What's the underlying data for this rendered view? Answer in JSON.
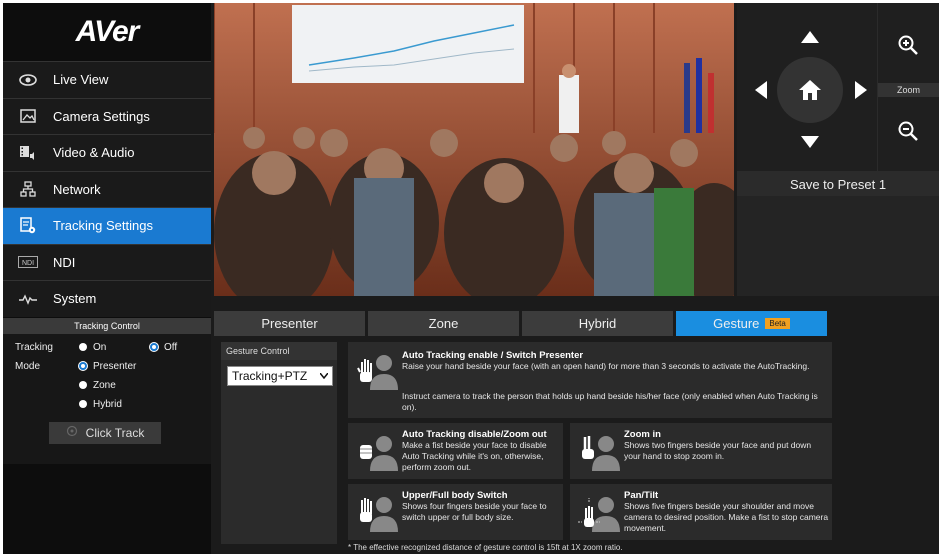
{
  "brand": {
    "logo_text": "AVer"
  },
  "sidebar": {
    "items": [
      {
        "label": "Live View",
        "icon": "eye-icon"
      },
      {
        "label": "Camera Settings",
        "icon": "image-icon"
      },
      {
        "label": "Video & Audio",
        "icon": "film-speaker-icon"
      },
      {
        "label": "Network",
        "icon": "network-icon"
      },
      {
        "label": "Tracking Settings",
        "icon": "settings-doc-icon",
        "active": true
      },
      {
        "label": "NDI",
        "icon": "ndi-icon"
      },
      {
        "label": "System",
        "icon": "pulse-icon"
      }
    ]
  },
  "tracking_control": {
    "header": "Tracking Control",
    "tracking_label": "Tracking",
    "mode_label": "Mode",
    "on_label": "On",
    "off_label": "Off",
    "tracking_selected": "Off",
    "modes": [
      "Presenter",
      "Zone",
      "Hybrid"
    ],
    "mode_selected": "Presenter",
    "click_track_label": "Click Track"
  },
  "ptz": {
    "zoom_label": "Zoom",
    "preset_label": "Save to Preset 1"
  },
  "tabs": [
    {
      "label": "Presenter"
    },
    {
      "label": "Zone"
    },
    {
      "label": "Hybrid"
    },
    {
      "label": "Gesture",
      "badge": "Beta",
      "active": true
    }
  ],
  "gesture": {
    "panel_title": "Gesture Control",
    "select_value": "Tracking+PTZ",
    "cards": [
      {
        "title": "Auto Tracking enable / Switch Presenter",
        "desc1": "Raise your hand beside your face (with an open hand) for more than 3 seconds to activate the AutoTracking.",
        "desc2": "Instruct camera to track the person that holds up hand beside his/her face (only enabled when Auto Tracking is on)."
      },
      {
        "title": "Auto Tracking disable/Zoom out",
        "desc1": "Make a fist beside your face to disable Auto Tracking while it's on, otherwise, perform zoom out."
      },
      {
        "title": "Zoom in",
        "desc1": "Shows two fingers beside your face and put down your hand to stop zoom in."
      },
      {
        "title": "Upper/Full body Switch",
        "desc1": "Shows four fingers beside your face to switch upper or full body size."
      },
      {
        "title": "Pan/Tilt",
        "desc1": "Shows five fingers beside your shoulder and move camera to desired position. Make a fist to stop camera movement."
      }
    ],
    "footnote": "* The effective recognized distance of gesture control is 15ft at 1X zoom ratio."
  },
  "colors": {
    "accent": "#1a7ad1",
    "tab_active": "#1a8ee0",
    "beta": "#f0a020"
  }
}
